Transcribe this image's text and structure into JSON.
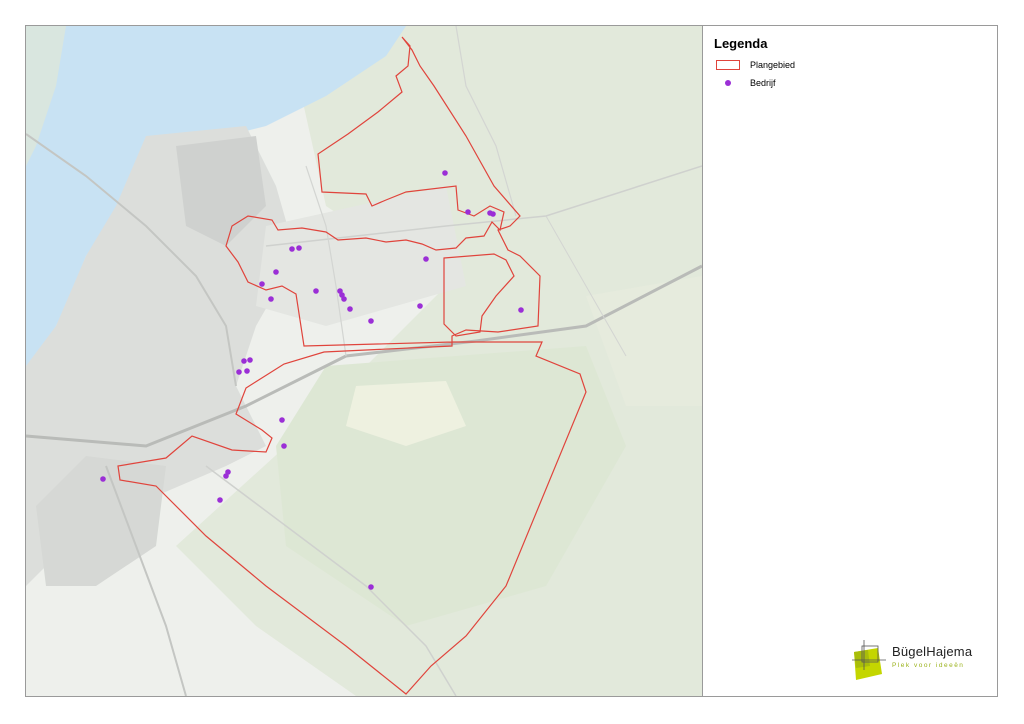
{
  "legend": {
    "title": "Legenda",
    "items": [
      {
        "label": "Plangebied",
        "symbol": "polygon-outline",
        "color": "#e0443c"
      },
      {
        "label": "Bedrijf",
        "symbol": "point",
        "color": "#9b2fd6"
      }
    ]
  },
  "logo": {
    "name": "BügelHajema",
    "tagline": "Plek voor ideeën",
    "colors": {
      "primary": "#c4d600",
      "secondary": "#7a9a10"
    }
  },
  "map": {
    "basemap": "light-gray-topographic",
    "boundary_color": "#e0443c",
    "point_color": "#9b2fd6",
    "water_color": "#c8e2f3",
    "urban_color": "#d9dbd8",
    "green_color": "#dfe8d8"
  }
}
